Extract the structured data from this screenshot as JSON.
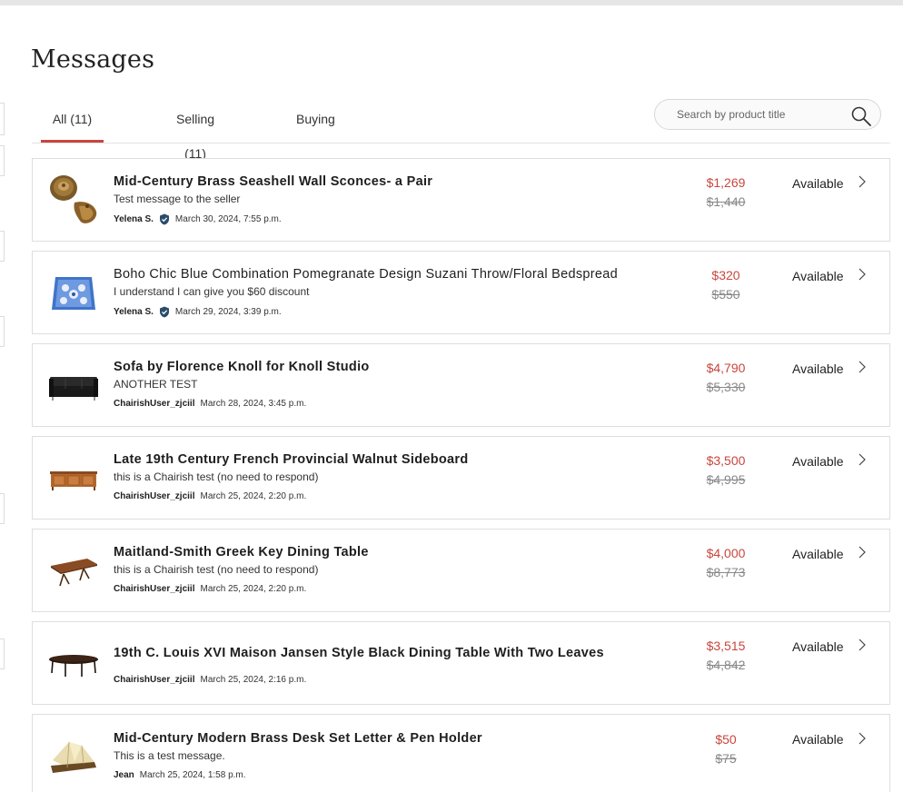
{
  "page": {
    "title": "Messages"
  },
  "tabs": [
    {
      "label": "All (11)",
      "active": true
    },
    {
      "label": "Selling (11)",
      "active": false
    },
    {
      "label": "Buying",
      "active": false
    }
  ],
  "search": {
    "placeholder": "Search by product title",
    "value": "",
    "icon": "search-icon"
  },
  "accent_color": "#c9463d",
  "messages": [
    {
      "title": "Mid-Century Brass Seashell Wall Sconces- a Pair",
      "message": "Test message to the seller",
      "user": "Yelena S.",
      "verified": true,
      "date": "March 30, 2024, 7:55 p.m.",
      "price": "$1,269",
      "original_price": "$1,440",
      "status": "Available",
      "thumb": "brass-seashell-sconces"
    },
    {
      "title": "Boho Chic Blue Combination Pomegranate Design Suzani Throw/Floral Bedspread",
      "message": "I understand I can give you $60 discount",
      "user": "Yelena S.",
      "verified": true,
      "date": "March 29, 2024, 3:39 p.m.",
      "price": "$320",
      "original_price": "$550",
      "status": "Available",
      "thumb": "blue-suzani-throw"
    },
    {
      "title": "Sofa by Florence Knoll for Knoll Studio",
      "message": "ANOTHER TEST",
      "user": "ChairishUser_zjciil",
      "verified": false,
      "date": "March 28, 2024, 3:45 p.m.",
      "price": "$4,790",
      "original_price": "$5,330",
      "status": "Available",
      "thumb": "black-leather-sofa"
    },
    {
      "title": "Late 19th Century French Provincial Walnut Sideboard",
      "message": "this is a Chairish test (no need to respond)",
      "user": "ChairishUser_zjciil",
      "verified": false,
      "date": "March 25, 2024, 2:20 p.m.",
      "price": "$3,500",
      "original_price": "$4,995",
      "status": "Available",
      "thumb": "walnut-sideboard"
    },
    {
      "title": "Maitland-Smith Greek Key Dining Table",
      "message": "this is a Chairish test (no need to respond)",
      "user": "ChairishUser_zjciil",
      "verified": false,
      "date": "March 25, 2024, 2:20 p.m.",
      "price": "$4,000",
      "original_price": "$8,773",
      "status": "Available",
      "thumb": "dining-table"
    },
    {
      "title": "19th C. Louis XVI Maison Jansen Style Black Dining Table With Two Leaves",
      "message": "",
      "user": "ChairishUser_zjciil",
      "verified": false,
      "date": "March 25, 2024, 2:16 p.m.",
      "price": "$3,515",
      "original_price": "$4,842",
      "status": "Available",
      "thumb": "black-dining-table"
    },
    {
      "title": "Mid-Century Modern Brass Desk Set Letter & Pen Holder",
      "message": "This is a test message.",
      "user": "Jean",
      "verified": false,
      "date": "March 25, 2024, 1:58 p.m.",
      "price": "$50",
      "original_price": "$75",
      "status": "Available",
      "thumb": "brass-desk-set"
    }
  ]
}
